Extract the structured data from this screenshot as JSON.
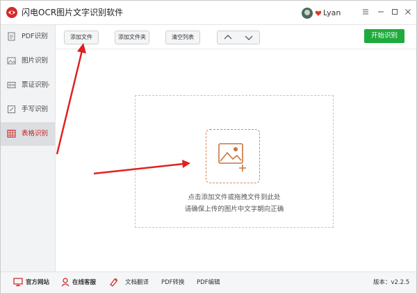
{
  "app": {
    "title": "闪电OCR图片文字识别软件",
    "brand_color": "#d42a2a"
  },
  "user": {
    "name": "Lyan"
  },
  "window_controls": {
    "menu": "≡",
    "minimize": "—",
    "maximize": "□",
    "close": "✕"
  },
  "sidebar": {
    "items": [
      {
        "label": "PDF识别",
        "icon": "pdf-icon"
      },
      {
        "label": "图片识别",
        "icon": "image-icon"
      },
      {
        "label": "票证识别",
        "icon": "ticket-icon"
      },
      {
        "label": "手写识别",
        "icon": "handwriting-icon"
      },
      {
        "label": "表格识别",
        "icon": "table-icon",
        "active": true
      }
    ],
    "active_color": "#c8201d"
  },
  "toolbar": {
    "add_file": "添加文件",
    "add_folder": "添加文件夹",
    "clear_list": "清空列表",
    "move_up": "∧",
    "move_down": "∨",
    "start": "开始识别",
    "start_color": "#1eaa3c"
  },
  "dropzone": {
    "hint_line1": "点击添加文件或拖拽文件到此处",
    "hint_line2": "请确保上传的图片中文字朝向正确"
  },
  "footer": {
    "website": "官方网站",
    "support": "在线客服",
    "translate": "文档翻译",
    "pdf_convert": "PDF转换",
    "pdf_edit": "PDF编辑",
    "version": "版本：v2.2.5"
  },
  "annotation_color": "#e02020"
}
